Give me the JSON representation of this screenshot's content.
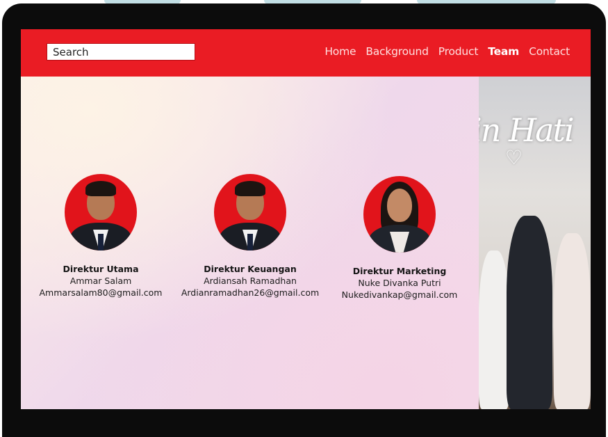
{
  "search": {
    "placeholder": "Search"
  },
  "nav": {
    "items": [
      {
        "label": "Home"
      },
      {
        "label": "Background"
      },
      {
        "label": "Product"
      },
      {
        "label": "Team"
      },
      {
        "label": "Contact"
      }
    ],
    "active": "Team"
  },
  "team": [
    {
      "role": "Direktur Utama",
      "name": "Ammar Salam",
      "email": "Ammarsalam80@gmail.com"
    },
    {
      "role": "Direktur Keuangan",
      "name": "Ardiansah Ramadhan",
      "email": "Ardianramadhan26@gmail.com"
    },
    {
      "role": "Direktur Marketing",
      "name": "Nuke Divanka Putri",
      "email": "Nukedivankap@gmail.com"
    }
  ],
  "photo": {
    "neon_text": "in Hati",
    "icon": "heart-icon"
  },
  "colors": {
    "nav": "#ea1c24",
    "bezel": "#0c0c0c",
    "avatar_bg": "#e1141b"
  }
}
